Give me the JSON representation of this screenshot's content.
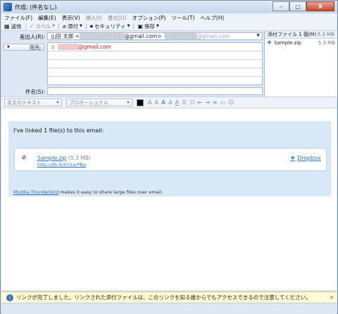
{
  "window": {
    "title": "作成: (件名なし)",
    "minimize": "–",
    "maximize": "□",
    "close": "X"
  },
  "menu": [
    "ファイル(F)",
    "編集(E)",
    "表示(V)",
    "挿入(I)",
    "書式(O)",
    "オプション(P)",
    "ツール(T)",
    "ヘルプ(H)"
  ],
  "toolbar": {
    "send": "送信",
    "spell": "スペル",
    "attach": "添付",
    "security": "セキュリティ",
    "save": "保存"
  },
  "header": {
    "from_label": "差出人(R):",
    "from_name": "山田 太郎 <",
    "from_email": "@gmail.com>",
    "from_alt": "@gmail.com",
    "to_type": "宛先:",
    "recipient_email": "@gmail.com",
    "subject_label": "件名(S):",
    "subject_value": ""
  },
  "attachments": {
    "title": "添付ファイル 1 個(M)",
    "total_size": "5.3 MB",
    "items": [
      {
        "name": "Sample.zip",
        "size": "5.3 MB"
      }
    ]
  },
  "format": {
    "paragraph": "本文のテキスト",
    "font": "プロポーショナル"
  },
  "body": {
    "intro": "I've linked 1 file(s) to this email:",
    "file_name": "Sample.zip",
    "file_size": "(5.3 MB)",
    "short_link": "http://db.tt/VY2arPBu",
    "service": "Dropbox",
    "footer_link": "Mozilla Thunderbird",
    "footer_text": " makes it easy to share large files over email."
  },
  "notification": {
    "text": "リンクが完了しました。リンクされた添付ファイルは、このリンクを知る誰からでもアクセスできるので注意してください。"
  }
}
